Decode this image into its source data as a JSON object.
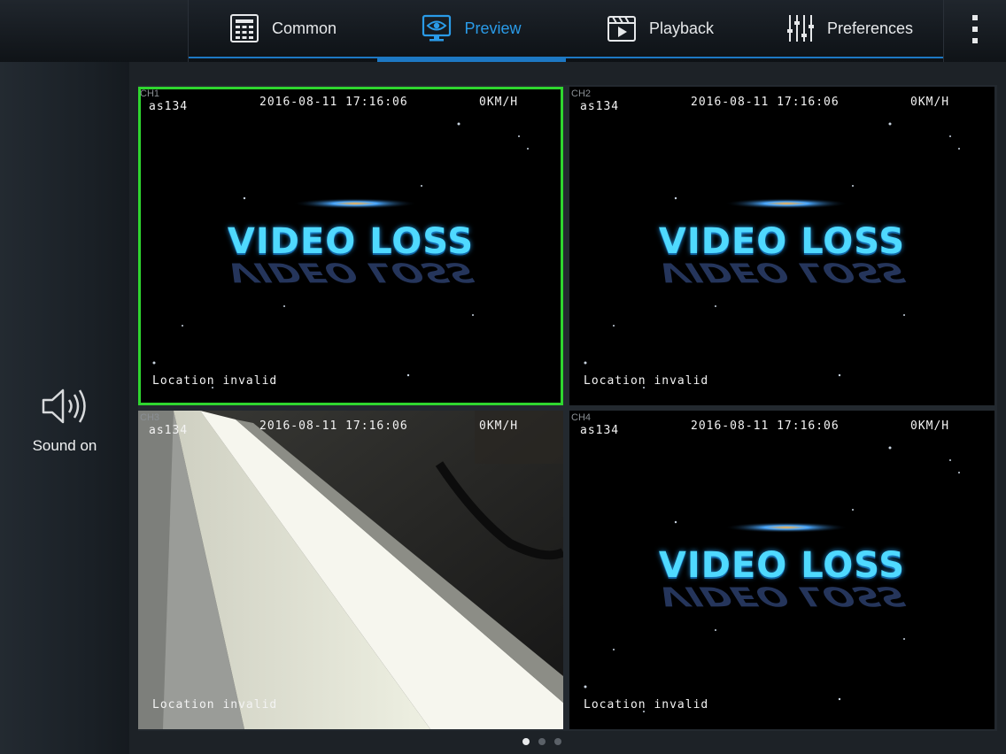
{
  "header": {
    "tabs": [
      {
        "label": "Common",
        "icon": "grid-menu-icon",
        "active": false
      },
      {
        "label": "Preview",
        "icon": "monitor-eye-icon",
        "active": true
      },
      {
        "label": "Playback",
        "icon": "clapperboard-play-icon",
        "active": false
      },
      {
        "label": "Preferences",
        "icon": "sliders-icon",
        "active": false
      }
    ],
    "menu_icon": "more-vertical-icon"
  },
  "sidebar": {
    "sound_label": "Sound on",
    "sound_icon": "speaker-icon"
  },
  "channels": [
    {
      "ch": "CH1",
      "device": "as134",
      "timestamp": "2016-08-11 17:16:06",
      "speed": "0KM/H",
      "location": "Location invalid",
      "status": "VIDEO LOSS",
      "selected": true
    },
    {
      "ch": "CH2",
      "device": "as134",
      "timestamp": "2016-08-11 17:16:06",
      "speed": "0KM/H",
      "location": "Location invalid",
      "status": "VIDEO LOSS",
      "selected": false
    },
    {
      "ch": "CH3",
      "device": "as134",
      "timestamp": "2016-08-11 17:16:06",
      "speed": "0KM/H",
      "location": "Location invalid",
      "status": "",
      "selected": false
    },
    {
      "ch": "CH4",
      "device": "as134",
      "timestamp": "2016-08-11 17:16:06",
      "speed": "0KM/H",
      "location": "Location invalid",
      "status": "VIDEO LOSS",
      "selected": false
    }
  ],
  "pager": {
    "pages": 3,
    "current": 1
  },
  "colors": {
    "accent": "#1d78c3",
    "active_tab_text": "#2a9be8",
    "selected_border": "#2fd62f",
    "video_loss_text": "#4fd9ff"
  }
}
